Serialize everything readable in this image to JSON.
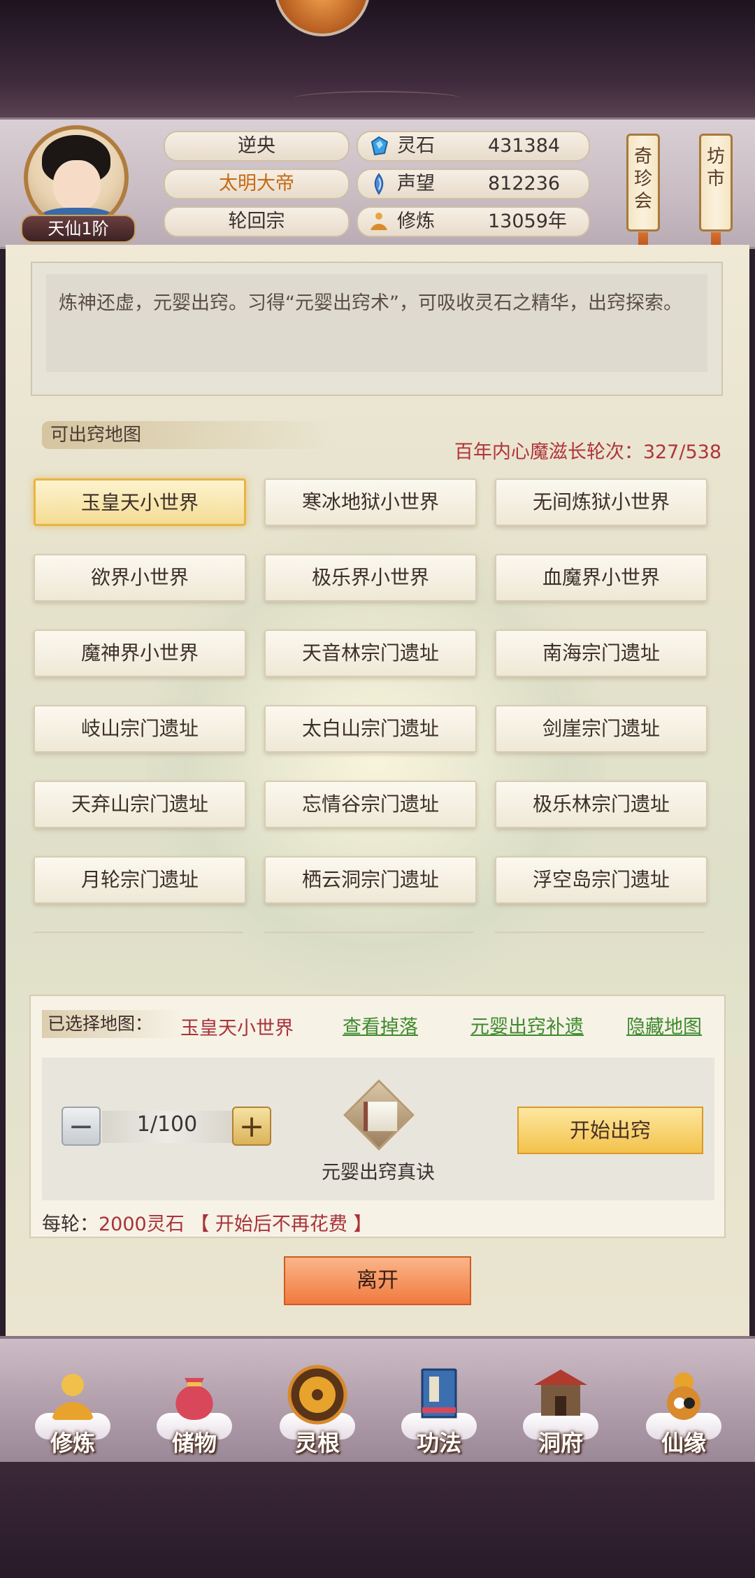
{
  "header": {
    "rank": "天仙1阶",
    "name": "逆央",
    "title": "太明大帝",
    "sect": "轮回宗",
    "resources": [
      {
        "label": "灵石",
        "value": "431384",
        "icon": "spirit-stone-icon"
      },
      {
        "label": "声望",
        "value": "812236",
        "icon": "reputation-icon"
      },
      {
        "label": "修炼",
        "value": "13059年",
        "icon": "cultivation-icon"
      }
    ],
    "side_buttons": [
      {
        "label": "奇珍会"
      },
      {
        "label": "坊市"
      }
    ]
  },
  "description": "炼神还虚，元婴出窍。习得“元婴出窍术”，可吸收灵石之精华，出窍探索。",
  "maps": {
    "title": "可出窍地图",
    "progress": "百年内心魔滋长轮次：327/538",
    "items": [
      "玉皇天小世界",
      "寒冰地狱小世界",
      "无间炼狱小世界",
      "欲界小世界",
      "极乐界小世界",
      "血魔界小世界",
      "魔神界小世界",
      "天音林宗门遗址",
      "南海宗门遗址",
      "岐山宗门遗址",
      "太白山宗门遗址",
      "剑崖宗门遗址",
      "天弃山宗门遗址",
      "忘情谷宗门遗址",
      "极乐林宗门遗址",
      "月轮宗门遗址",
      "栖云洞宗门遗址",
      "浮空岛宗门遗址"
    ],
    "selected_index": 0
  },
  "selection": {
    "label": "已选择地图：",
    "value": "玉皇天小世界",
    "links": [
      "查看掉落",
      "元婴出窍补遗",
      "隐藏地图"
    ],
    "stepper_minus": "−",
    "stepper_plus": "+",
    "quantity": "1/100",
    "item_name": "元婴出窍真诀",
    "start_button": "开始出窍",
    "cost_prefix": "每轮：",
    "cost_value": "2000灵石",
    "cost_note": "【 开始后不再花费 】"
  },
  "leave_button": "离开",
  "nav": [
    {
      "label": "修炼",
      "icon": "cultivate-icon"
    },
    {
      "label": "储物",
      "icon": "storage-bag-icon"
    },
    {
      "label": "灵根",
      "icon": "spirit-root-icon"
    },
    {
      "label": "功法",
      "icon": "technique-book-icon"
    },
    {
      "label": "洞府",
      "icon": "cave-dwelling-icon"
    },
    {
      "label": "仙缘",
      "icon": "immortal-fate-icon"
    }
  ],
  "colors": {
    "accent_red": "#a8323a",
    "link_green": "#3e8a2e",
    "title_orange": "#c66a14"
  }
}
